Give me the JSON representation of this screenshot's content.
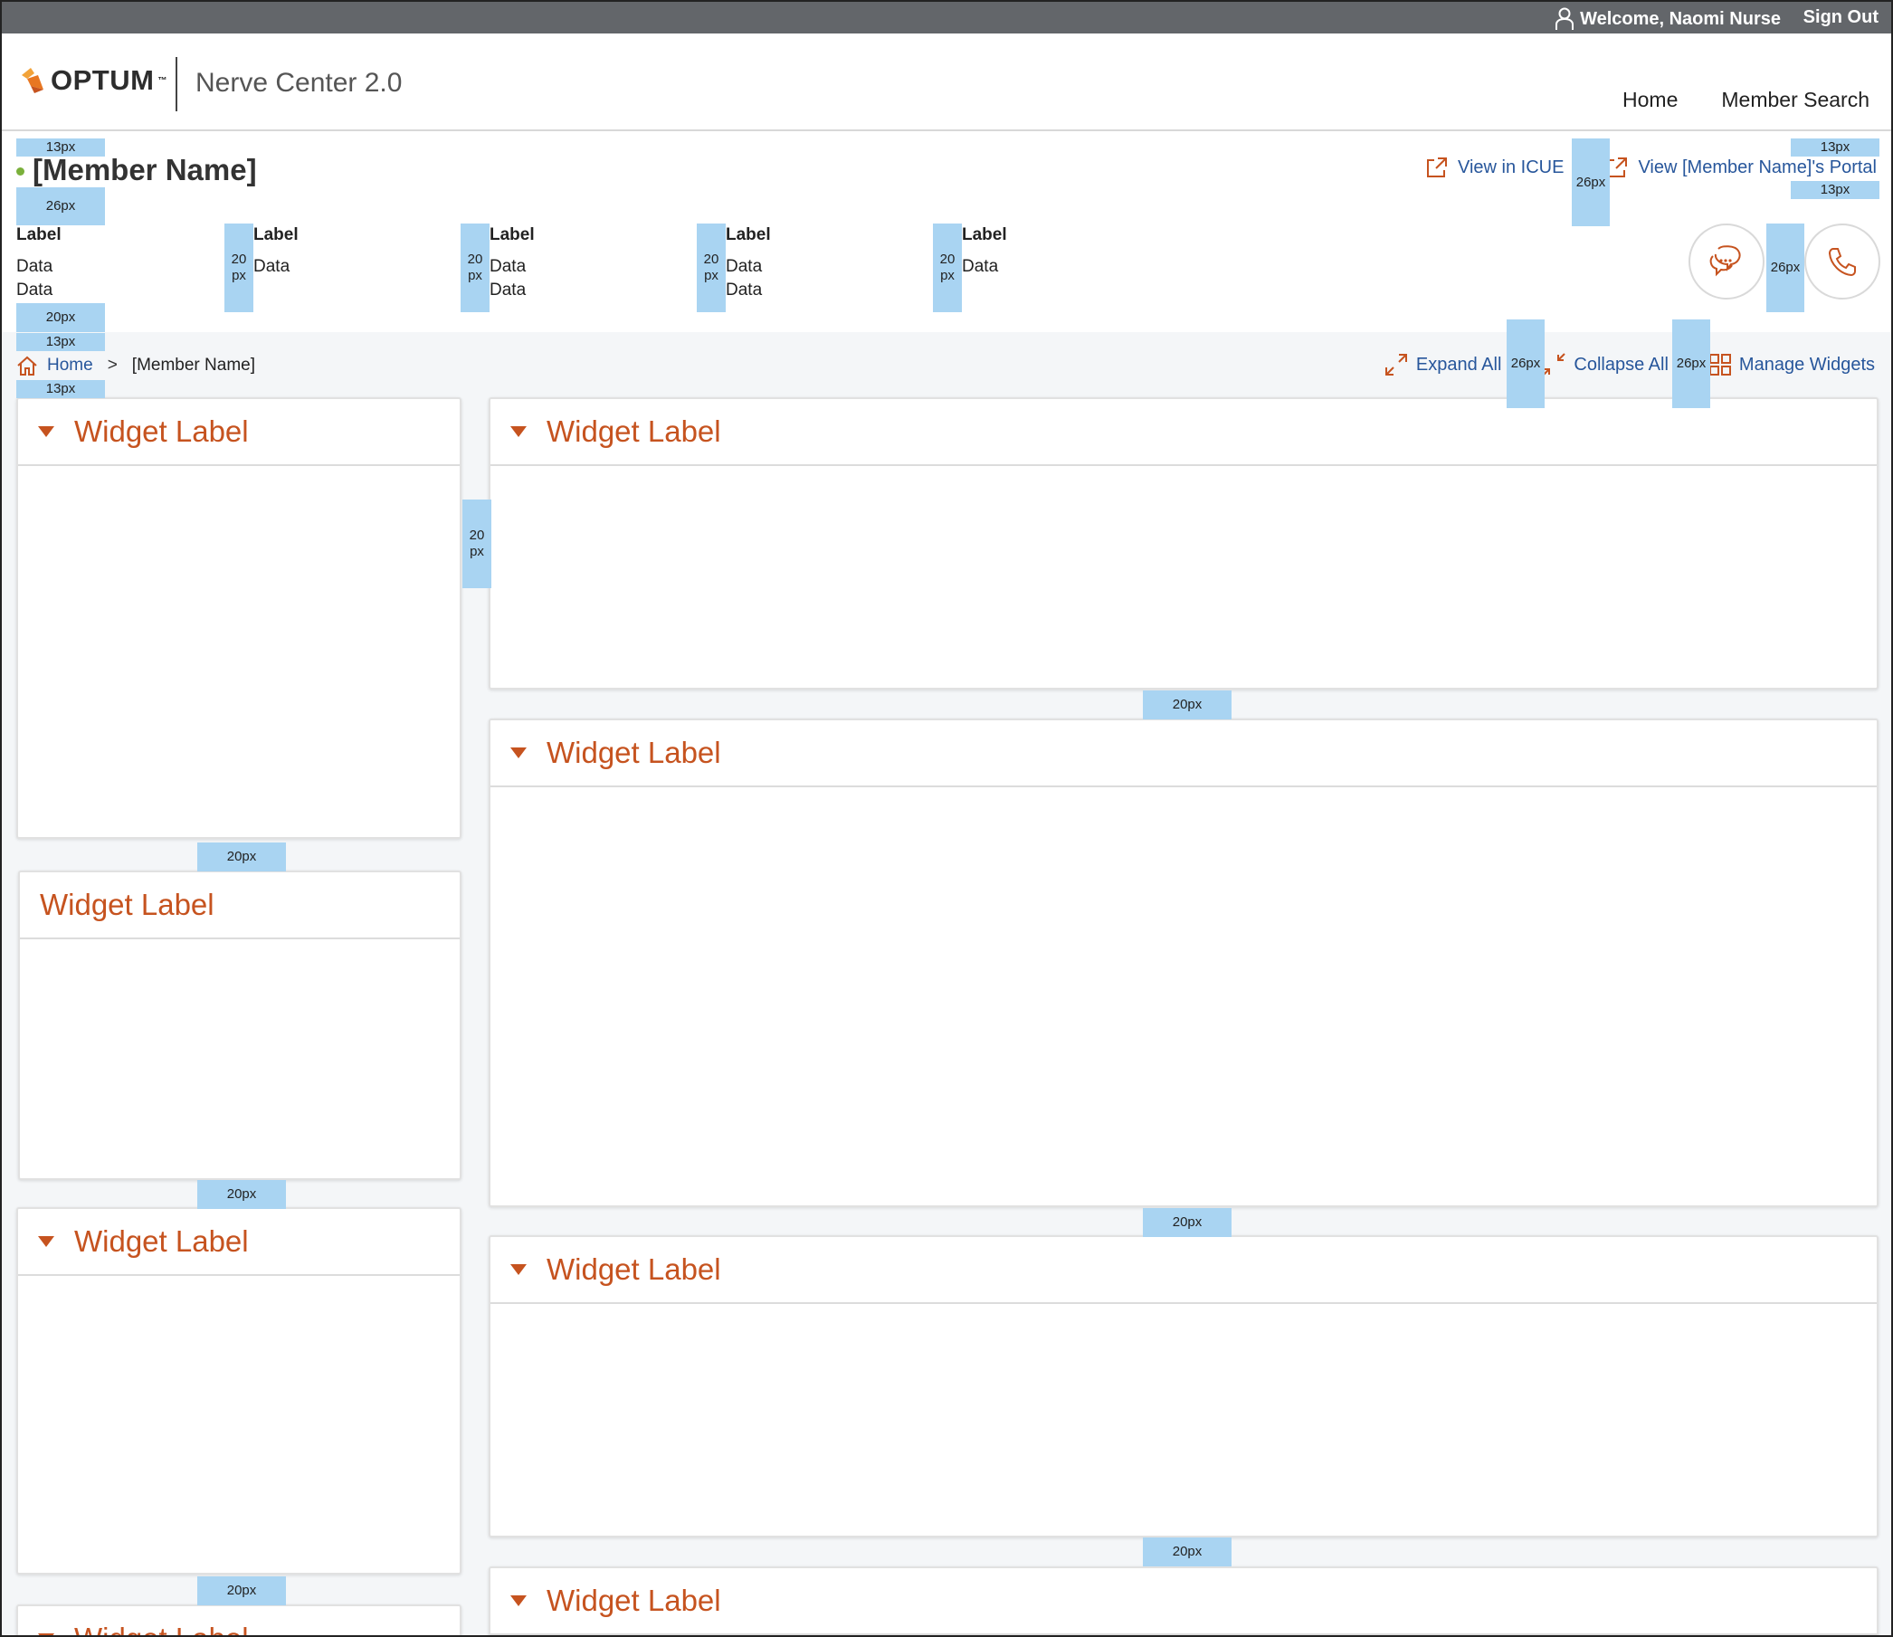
{
  "topbar": {
    "welcome": "Welcome, Naomi Nurse",
    "sign_out": "Sign Out"
  },
  "header": {
    "logo": "OPTUM",
    "logo_tm": "™",
    "app_title": "Nerve Center 2.0",
    "nav": [
      "Home",
      "Member Search"
    ]
  },
  "member": {
    "name": "[Member Name]",
    "view_icue": "View in ICUE",
    "view_portal": "View [Member Name]'s Portal",
    "info": [
      {
        "label": "Label",
        "data": [
          "Data",
          "Data"
        ]
      },
      {
        "label": "Label",
        "data": [
          "Data"
        ]
      },
      {
        "label": "Label",
        "data": [
          "Data",
          "Data"
        ]
      },
      {
        "label": "Label",
        "data": [
          "Data",
          "Data"
        ]
      },
      {
        "label": "Label",
        "data": [
          "Data"
        ]
      }
    ]
  },
  "breadcrumb": {
    "home": "Home",
    "separator": ">",
    "current": "[Member Name]"
  },
  "actions": {
    "expand_all": "Expand All",
    "collapse_all": "Collapse All",
    "manage_widgets": "Manage Widgets"
  },
  "widgets": {
    "left": [
      "Widget Label",
      "Widget Label",
      "Widget Label",
      "Widget Label"
    ],
    "right": [
      "Widget Label",
      "Widget Label",
      "Widget Label",
      "Widget Label"
    ]
  },
  "spacers": {
    "s13": "13px",
    "s26": "26px",
    "s20": "20px",
    "s20_l1": "20",
    "s20_l2": "px"
  },
  "colors": {
    "accent": "#c6531f",
    "link": "#27569b",
    "topbar": "#63666a",
    "spacer": "#a9d4f2"
  }
}
